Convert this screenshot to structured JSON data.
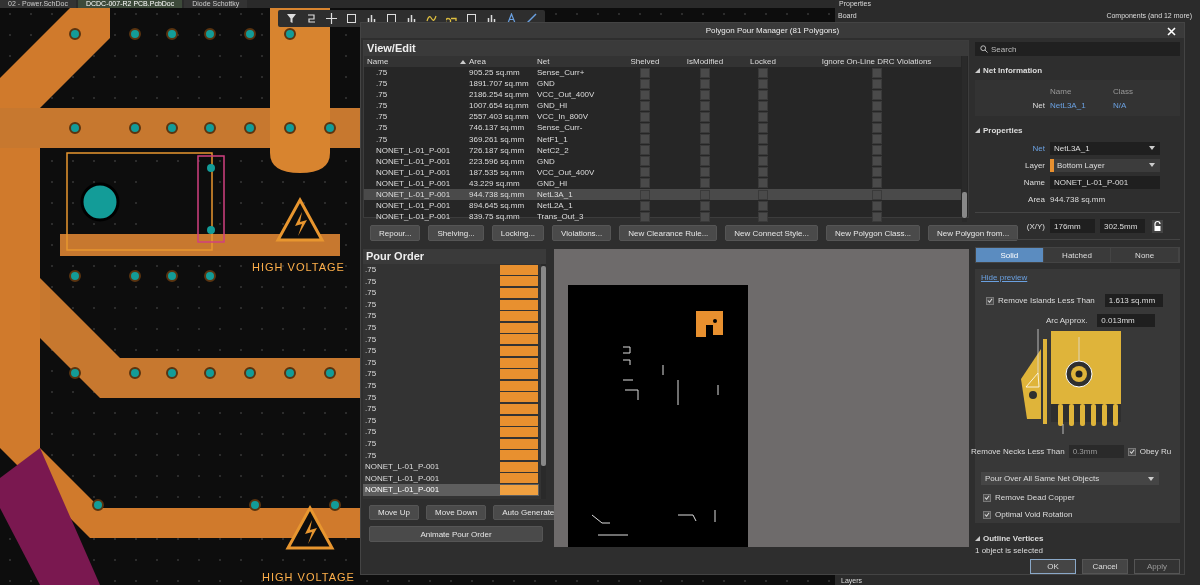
{
  "document_tabs": [
    {
      "label": "02 - Power.SchDoc",
      "selected": false
    },
    {
      "label": "DCDC-007-R2 PCB.PcbDoc",
      "selected": true
    },
    {
      "label": "Diode Schottky",
      "selected": false
    }
  ],
  "canvas": {
    "labels": [
      "HIGH VOLTAGE",
      "HIGH VOLTAGE"
    ]
  },
  "properties_panel": {
    "title": "Properties",
    "section": "Board",
    "filter": "Components (and 12 more)",
    "footer": "Layers"
  },
  "dialog": {
    "title": "Polygon Pour Manager (81 Polygons)",
    "view_edit": {
      "title": "View/Edit",
      "columns": [
        "Name",
        "Area",
        "Net",
        "Shelved",
        "IsModified",
        "Locked",
        "Ignore On-Line DRC Violations"
      ],
      "rows": [
        {
          "name": ".75",
          "area": "905.25 sq.mm",
          "net": "Sense_Curr+",
          "shelved": false,
          "is_modified": false,
          "locked": false,
          "ignore_drc": false,
          "selected": false
        },
        {
          "name": ".75",
          "area": "1891.707 sq.mm",
          "net": "GND",
          "shelved": false,
          "is_modified": false,
          "locked": false,
          "ignore_drc": false,
          "selected": false
        },
        {
          "name": ".75",
          "area": "2186.254 sq.mm",
          "net": "VCC_Out_400V",
          "shelved": false,
          "is_modified": false,
          "locked": false,
          "ignore_drc": false,
          "selected": false
        },
        {
          "name": ".75",
          "area": "1007.654 sq.mm",
          "net": "GND_HI",
          "shelved": false,
          "is_modified": false,
          "locked": false,
          "ignore_drc": false,
          "selected": false
        },
        {
          "name": ".75",
          "area": "2557.403 sq.mm",
          "net": "VCC_In_800V",
          "shelved": false,
          "is_modified": false,
          "locked": false,
          "ignore_drc": false,
          "selected": false
        },
        {
          "name": ".75",
          "area": "746.137 sq.mm",
          "net": "Sense_Curr-",
          "shelved": false,
          "is_modified": false,
          "locked": false,
          "ignore_drc": false,
          "selected": false
        },
        {
          "name": ".75",
          "area": "369.261 sq.mm",
          "net": "NetF1_1",
          "shelved": false,
          "is_modified": false,
          "locked": false,
          "ignore_drc": false,
          "selected": false
        },
        {
          "name": "NONET_L-01_P-001",
          "area": "726.187 sq.mm",
          "net": "NetC2_2",
          "shelved": false,
          "is_modified": false,
          "locked": false,
          "ignore_drc": false,
          "selected": false
        },
        {
          "name": "NONET_L-01_P-001",
          "area": "223.596 sq.mm",
          "net": "GND",
          "shelved": false,
          "is_modified": false,
          "locked": false,
          "ignore_drc": false,
          "selected": false
        },
        {
          "name": "NONET_L-01_P-001",
          "area": "187.535 sq.mm",
          "net": "VCC_Out_400V",
          "shelved": false,
          "is_modified": false,
          "locked": false,
          "ignore_drc": false,
          "selected": false
        },
        {
          "name": "NONET_L-01_P-001",
          "area": "43.229 sq.mm",
          "net": "GND_HI",
          "shelved": false,
          "is_modified": false,
          "locked": false,
          "ignore_drc": false,
          "selected": false
        },
        {
          "name": "NONET_L-01_P-001",
          "area": "944.738 sq.mm",
          "net": "NetL3A_1",
          "shelved": false,
          "is_modified": false,
          "locked": false,
          "ignore_drc": false,
          "selected": true
        },
        {
          "name": "NONET_L-01_P-001",
          "area": "894.645 sq.mm",
          "net": "NetL2A_1",
          "shelved": false,
          "is_modified": false,
          "locked": false,
          "ignore_drc": false,
          "selected": false
        },
        {
          "name": "NONET_L-01_P-001",
          "area": "839.75 sq.mm",
          "net": "Trans_Out_3",
          "shelved": false,
          "is_modified": false,
          "locked": false,
          "ignore_drc": false,
          "selected": false
        }
      ]
    },
    "action_buttons": [
      "Repour...",
      "Shelving...",
      "Locking...",
      "Violations...",
      "New Clearance Rule...",
      "New Connect Style...",
      "New Polygon Class...",
      "New Polygon from..."
    ],
    "pour_order": {
      "title": "Pour Order",
      "items": [
        {
          "name": ".75",
          "selected": false
        },
        {
          "name": ".75",
          "selected": false
        },
        {
          "name": ".75",
          "selected": false
        },
        {
          "name": ".75",
          "selected": false
        },
        {
          "name": ".75",
          "selected": false
        },
        {
          "name": ".75",
          "selected": false
        },
        {
          "name": ".75",
          "selected": false
        },
        {
          "name": ".75",
          "selected": false
        },
        {
          "name": ".75",
          "selected": false
        },
        {
          "name": ".75",
          "selected": false
        },
        {
          "name": ".75",
          "selected": false
        },
        {
          "name": ".75",
          "selected": false
        },
        {
          "name": ".75",
          "selected": false
        },
        {
          "name": ".75",
          "selected": false
        },
        {
          "name": ".75",
          "selected": false
        },
        {
          "name": ".75",
          "selected": false
        },
        {
          "name": ".75",
          "selected": false
        },
        {
          "name": "NONET_L-01_P-001",
          "selected": false
        },
        {
          "name": "NONET_L-01_P-001",
          "selected": false
        },
        {
          "name": "NONET_L-01_P-001",
          "selected": true
        }
      ],
      "buttons": [
        "Move Up",
        "Move Down",
        "Auto Generate"
      ],
      "animate_button": "Animate Pour Order"
    },
    "search": {
      "placeholder": "Search"
    },
    "net_information": {
      "title": "Net Information",
      "name_header": "Name",
      "class_header": "Class",
      "label": "Net",
      "name": "NetL3A_1",
      "class": "N/A"
    },
    "properties": {
      "title": "Properties",
      "net_label": "Net",
      "net": "NetL3A_1",
      "layer_label": "Layer",
      "layer": "Bottom Layer",
      "name_label": "Name",
      "name": "NONET_L-01_P-001",
      "area_label": "Area",
      "area": "944.738 sq.mm",
      "xy_label": "(X/Y)",
      "x": "176mm",
      "y": "302.5mm"
    },
    "fill_modes": [
      {
        "label": "Solid",
        "selected": true
      },
      {
        "label": "Hatched",
        "selected": false
      },
      {
        "label": "None",
        "selected": false
      }
    ],
    "hide_preview": "Hide preview",
    "remove_islands": {
      "label": "Remove Islands Less Than",
      "checked": true,
      "value": "1.613 sq.mm"
    },
    "arc_approx": {
      "label": "Arc Approx.",
      "value": "0.013mm"
    },
    "remove_necks": {
      "label": "Remove Necks Less Than",
      "value": "0.3mm",
      "disabled": true
    },
    "obey_rules": {
      "label": "Obey Ru",
      "checked": true
    },
    "pour_over": "Pour Over All Same Net Objects",
    "options": [
      {
        "label": "Remove Dead Copper",
        "checked": true
      },
      {
        "label": "Optimal Void Rotation",
        "checked": true
      }
    ],
    "outline_vertices": "Outline Vertices",
    "status": "1 object is selected",
    "buttons": [
      {
        "label": "OK",
        "disabled": false,
        "default": true
      },
      {
        "label": "Cancel",
        "disabled": false,
        "default": false
      },
      {
        "label": "Apply",
        "disabled": true,
        "default": false
      }
    ]
  }
}
